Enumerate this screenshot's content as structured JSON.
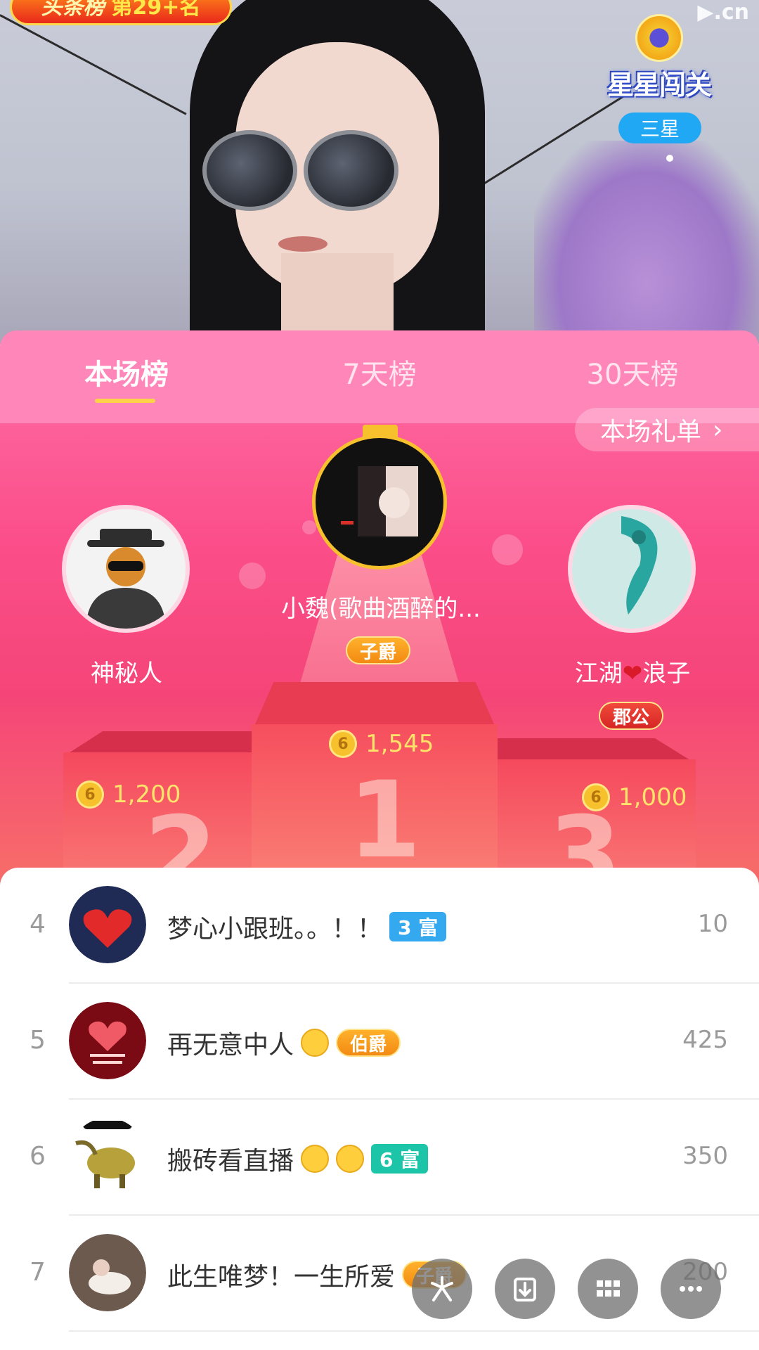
{
  "video": {
    "rank_tag": "头条榜",
    "rank_text": "第29+名",
    "watermark": "▶.cn",
    "star_challenge": {
      "title": "星星闯关",
      "level": "三星"
    }
  },
  "tabs": [
    {
      "label": "本场榜",
      "active": true
    },
    {
      "label": "7天榜",
      "active": false
    },
    {
      "label": "30天榜",
      "active": false
    }
  ],
  "gift_link": {
    "label": "本场礼单",
    "arrow": "›"
  },
  "podium": {
    "first": {
      "name": "小魏(歌曲酒醉的...",
      "badge": "子爵",
      "score": "1,545",
      "rank_glyph": "1"
    },
    "second": {
      "name": "神秘人",
      "score": "1,200",
      "rank_glyph": "2"
    },
    "third": {
      "name_prefix": "江湖",
      "heart": "❤",
      "name_suffix": "浪子",
      "badge": "郡公",
      "score": "1,000",
      "rank_glyph": "3"
    }
  },
  "coin_symbol": "6",
  "list": [
    {
      "rank": "4",
      "name": "梦心小跟班。。！！",
      "badge": "3 富",
      "badge_kind": "rich-blue",
      "value": "10"
    },
    {
      "rank": "5",
      "name": "再无意中人",
      "emoji": true,
      "badge": "伯爵",
      "badge_kind": "noble",
      "value": "425"
    },
    {
      "rank": "6",
      "name": "搬砖看直播",
      "emoji": true,
      "emoji2": true,
      "badge": "6 富",
      "badge_kind": "rich-teal",
      "value": "350"
    },
    {
      "rank": "7",
      "name": "此生唯梦！一生所爱",
      "badge": "子爵",
      "badge_kind": "noble",
      "value": "200"
    }
  ],
  "fab_icons": [
    "share-icon",
    "download-icon",
    "grid-icon",
    "more-icon"
  ],
  "colors": {
    "accent": "#fb4e8a",
    "gold": "#f7c12d",
    "score": "#ffe36a"
  }
}
